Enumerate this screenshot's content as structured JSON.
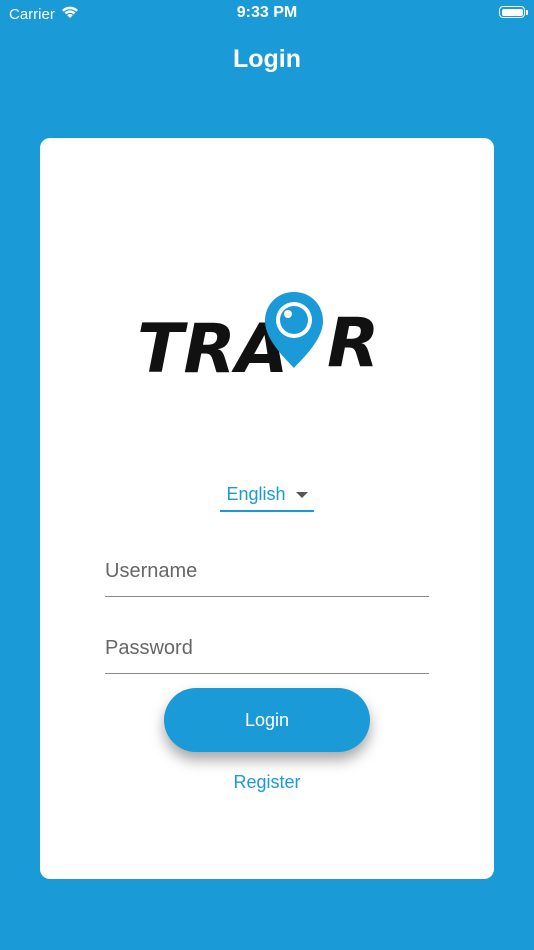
{
  "status_bar": {
    "carrier": "Carrier",
    "time": "9:33 PM"
  },
  "nav": {
    "title": "Login"
  },
  "logo": {
    "text_left": "TRA",
    "text_right": "R"
  },
  "language": {
    "selected": "English"
  },
  "form": {
    "username_placeholder": "Username",
    "password_placeholder": "Password",
    "login_label": "Login",
    "register_label": "Register"
  },
  "colors": {
    "accent": "#1a9ad6",
    "card": "#ffffff"
  }
}
